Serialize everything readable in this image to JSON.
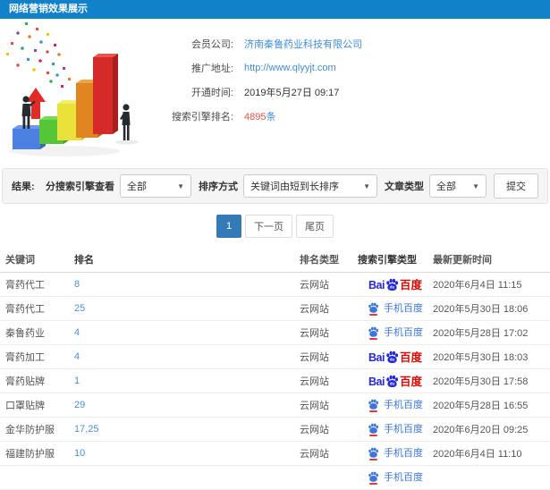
{
  "header": {
    "title": "网络营销效果展示"
  },
  "info": {
    "rows": [
      {
        "label": "会员公司:",
        "value": "济南秦鲁药业科技有限公司",
        "style": "link"
      },
      {
        "label": "推广地址:",
        "value": "http://www.qlyyjt.com",
        "style": "link"
      },
      {
        "label": "开通时间:",
        "value": "2019年5月27日 09:17",
        "style": "plain"
      },
      {
        "label": "搜索引擎排名:",
        "value": "4895",
        "suffix": "条",
        "style": "count"
      }
    ]
  },
  "filters": {
    "result_label": "结果:",
    "engine_view_label": "分搜索引擎查看",
    "engine_view_value": "全部",
    "sort_label": "排序方式",
    "sort_value": "关键词由短到长排序",
    "article_type_label": "文章类型",
    "article_type_value": "全部",
    "submit_label": "提交",
    "caret": "▼"
  },
  "pagination": {
    "current": "1",
    "next": "下一页",
    "last": "尾页"
  },
  "table": {
    "headers": [
      "关键词",
      "排名",
      "排名类型",
      "搜索引擎类型",
      "最新更新时间"
    ],
    "engine_labels": {
      "baidu_bai": "Bai",
      "baidu_du": "du",
      "baidu_cn": "百度",
      "mobile": "手机百度"
    },
    "rows": [
      {
        "keyword": "膏药代工",
        "rank": "8",
        "rank_type": "云网站",
        "engine": "baidu",
        "updated": "2020年6月4日 11:15"
      },
      {
        "keyword": "膏药代工",
        "rank": "25",
        "rank_type": "云网站",
        "engine": "baidu-mobile",
        "updated": "2020年5月30日 18:06"
      },
      {
        "keyword": "秦鲁药业",
        "rank": "4",
        "rank_type": "云网站",
        "engine": "baidu-mobile",
        "updated": "2020年5月28日 17:02"
      },
      {
        "keyword": "膏药加工",
        "rank": "4",
        "rank_type": "云网站",
        "engine": "baidu",
        "updated": "2020年5月30日 18:03"
      },
      {
        "keyword": "膏药贴牌",
        "rank": "1",
        "rank_type": "云网站",
        "engine": "baidu",
        "updated": "2020年5月30日 17:58"
      },
      {
        "keyword": "口罩贴牌",
        "rank": "29",
        "rank_type": "云网站",
        "engine": "baidu-mobile",
        "updated": "2020年5月28日 16:55"
      },
      {
        "keyword": "金华防护服",
        "rank": "17,25",
        "rank_type": "云网站",
        "engine": "baidu-mobile",
        "updated": "2020年6月20日 09:25"
      },
      {
        "keyword": "福建防护服",
        "rank": "10",
        "rank_type": "云网站",
        "engine": "baidu-mobile",
        "updated": "2020年6月4日 11:10"
      },
      {
        "keyword": "",
        "rank": "",
        "rank_type": "",
        "engine": "baidu-mobile",
        "updated": ""
      }
    ]
  },
  "colors": {
    "titlebar_bg": "#1182c9",
    "link_blue": "#3e8ede",
    "count_red": "#e8533b",
    "baidu_blue": "#2529d8",
    "baidu_red": "#e10601",
    "mobile_baidu_blue": "#3a76dd",
    "pagination_active": "#337ab7",
    "panel_bg": "#f5f5f5"
  }
}
